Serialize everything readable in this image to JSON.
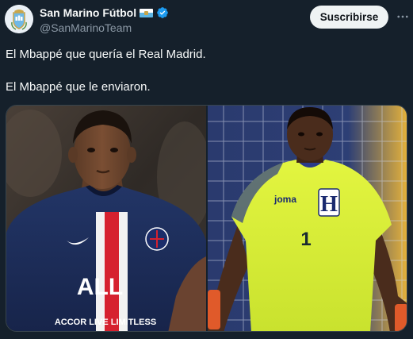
{
  "account": {
    "display_name": "San Marino Fútbol",
    "handle": "@SanMarinoTeam",
    "avatar_icon": "san-marino-crest-icon",
    "flag_icon": "san-marino-flag-icon",
    "verified_icon": "verified-badge-icon"
  },
  "actions": {
    "subscribe_label": "Suscribirse",
    "more_icon": "more-options-icon"
  },
  "post": {
    "line1": "El Mbappé que quería el Real Madrid.",
    "line2": "El Mbappé que le enviaron."
  },
  "media": {
    "left_photo": {
      "jersey_text": "ACCOR LIVE LIMITLESS",
      "jersey_brand": "ALL"
    },
    "right_photo": {
      "jersey_letter": "H",
      "jersey_brand": "joma",
      "jersey_number": "1"
    }
  },
  "colors": {
    "background": "#15202b",
    "text_primary": "#f7f9f9",
    "text_secondary": "#8b98a5",
    "verified": "#1d9bf0",
    "psg_navy": "#1b2a4e",
    "keeper_yellow": "#d6ef3b"
  }
}
